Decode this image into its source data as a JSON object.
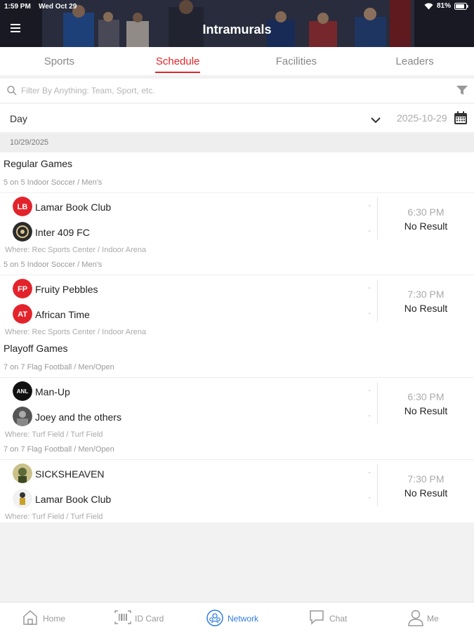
{
  "status_bar": {
    "time": "1:59 PM",
    "date": "Wed Oct 29",
    "battery": "81%"
  },
  "header": {
    "title": "Intramurals",
    "menu_icon": "hamburger-menu-icon"
  },
  "tabs": [
    {
      "label": "Sports",
      "active": false
    },
    {
      "label": "Schedule",
      "active": true
    },
    {
      "label": "Facilities",
      "active": false
    },
    {
      "label": "Leaders",
      "active": false
    }
  ],
  "search": {
    "placeholder": "Filter By Anything: Team, Sport, etc.",
    "value": ""
  },
  "view": {
    "period": "Day",
    "date": "2025-10-29"
  },
  "date_header": "10/29/2025",
  "sections": [
    {
      "title": "Regular Games",
      "games": [
        {
          "league": "5 on 5 Indoor Soccer / Men's",
          "teams": [
            {
              "name": "Lamar Book Club",
              "score": "-"
            },
            {
              "name": "Inter 409 FC",
              "score": "-"
            }
          ],
          "time": "6:30 PM",
          "result": "No Result",
          "where": "Where: Rec Sports Center / Indoor Arena"
        },
        {
          "league": "5 on 5 Indoor Soccer / Men's",
          "teams": [
            {
              "name": "Fruity Pebbles",
              "score": "-"
            },
            {
              "name": "African Time",
              "score": "-"
            }
          ],
          "time": "7:30 PM",
          "result": "No Result",
          "where": "Where: Rec Sports Center / Indoor Arena"
        }
      ]
    },
    {
      "title": "Playoff Games",
      "games": [
        {
          "league": "7 on 7 Flag Football / Men/Open",
          "teams": [
            {
              "name": "Man-Up",
              "score": "-"
            },
            {
              "name": "Joey and the others",
              "score": "-"
            }
          ],
          "time": "6:30 PM",
          "result": "No Result",
          "where": "Where: Turf Field / Turf Field"
        },
        {
          "league": "7 on 7 Flag Football / Men/Open",
          "teams": [
            {
              "name": "SICKSHEAVEN",
              "score": "-"
            },
            {
              "name": "Lamar Book Club",
              "score": "-"
            }
          ],
          "time": "7:30 PM",
          "result": "No Result",
          "where": "Where: Turf Field / Turf Field"
        }
      ]
    }
  ],
  "bottom_nav": [
    {
      "label": "Home",
      "icon": "home-icon",
      "active": false
    },
    {
      "label": "ID Card",
      "icon": "id-card-icon",
      "active": false
    },
    {
      "label": "Network",
      "icon": "network-icon",
      "active": true
    },
    {
      "label": "Chat",
      "icon": "chat-icon",
      "active": false
    },
    {
      "label": "Me",
      "icon": "person-icon",
      "active": false
    }
  ],
  "colors": {
    "accent": "#e0262a",
    "nav_active": "#2f7de1",
    "header_bg": "#1c1c24"
  }
}
